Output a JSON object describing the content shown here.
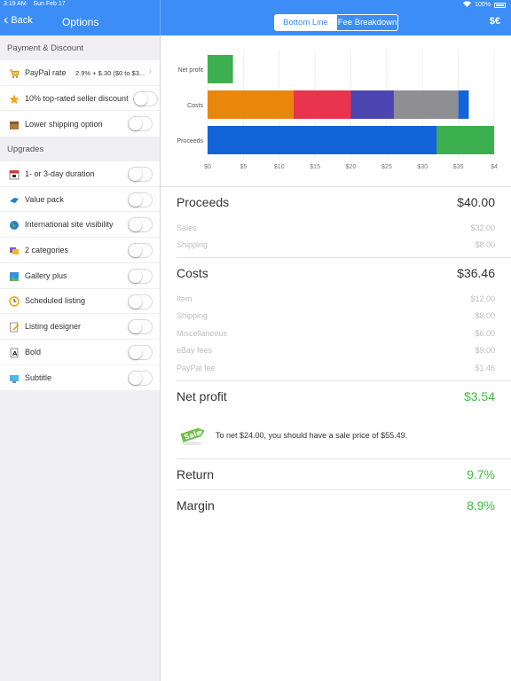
{
  "status": {
    "time": "3:19 AM",
    "date": "Sun Feb 17",
    "battery": "100%"
  },
  "nav": {
    "back_label": "Back",
    "title": "Options",
    "segments": [
      "Bottom Line",
      "Fee Breakdown"
    ],
    "selected_segment": "Bottom Line",
    "right_icon": "$€"
  },
  "sidebar": {
    "sections": [
      {
        "header": "Payment & Discount",
        "items": [
          {
            "label": "PayPal rate",
            "detail": "2.9% + $.30 ($0 to $3...",
            "icon": "cart-icon",
            "control": "disclosure"
          },
          {
            "label": "10% top-rated seller discount",
            "icon": "star-icon",
            "control": "toggle",
            "on": false
          },
          {
            "label": "Lower shipping option",
            "icon": "box-icon",
            "control": "toggle",
            "on": false
          }
        ]
      },
      {
        "header": "Upgrades",
        "items": [
          {
            "label": "1- or 3-day duration",
            "icon": "calendar-icon",
            "control": "toggle",
            "on": false
          },
          {
            "label": "Value pack",
            "icon": "tag-icon",
            "control": "toggle",
            "on": false
          },
          {
            "label": "International site visibility",
            "icon": "globe-icon",
            "control": "toggle",
            "on": false
          },
          {
            "label": "2 categories",
            "icon": "folders-icon",
            "control": "toggle",
            "on": false
          },
          {
            "label": "Gallery plus",
            "icon": "gallery-icon",
            "control": "toggle",
            "on": false
          },
          {
            "label": "Scheduled listing",
            "icon": "clock-icon",
            "control": "toggle",
            "on": false
          },
          {
            "label": "Listing designer",
            "icon": "designer-icon",
            "control": "toggle",
            "on": false
          },
          {
            "label": "Bold",
            "icon": "bold-icon",
            "control": "toggle",
            "on": false
          },
          {
            "label": "Subtitle",
            "icon": "subtitle-icon",
            "control": "toggle",
            "on": false
          }
        ]
      }
    ]
  },
  "chart_data": {
    "type": "bar",
    "orientation": "horizontal",
    "stacked": true,
    "categories": [
      "Net profit",
      "Costs",
      "Proceeds"
    ],
    "xlim": [
      0,
      40
    ],
    "xticks": [
      "$0",
      "$5",
      "$10",
      "$15",
      "$20",
      "$25",
      "$30",
      "$35",
      "$4"
    ],
    "grid": true,
    "bars": [
      {
        "category": "Net profit",
        "segments": [
          {
            "value": 3.54,
            "color": "#3cb04e"
          }
        ]
      },
      {
        "category": "Costs",
        "segments": [
          {
            "value": 12.0,
            "color": "#e8870c"
          },
          {
            "value": 8.0,
            "color": "#e8344e"
          },
          {
            "value": 6.0,
            "color": "#4a45b0"
          },
          {
            "value": 9.0,
            "color": "#8e8e93"
          },
          {
            "value": 1.46,
            "color": "#1264d8"
          }
        ]
      },
      {
        "category": "Proceeds",
        "segments": [
          {
            "value": 32.0,
            "color": "#1264d8"
          },
          {
            "value": 8.0,
            "color": "#3cb04e"
          }
        ]
      }
    ]
  },
  "summary": {
    "proceeds": {
      "label": "Proceeds",
      "value": "$40.00",
      "items": [
        {
          "label": "Sales",
          "value": "$32.00"
        },
        {
          "label": "Shipping",
          "value": "$8.00"
        }
      ]
    },
    "costs": {
      "label": "Costs",
      "value": "$36.46",
      "items": [
        {
          "label": "Item",
          "value": "$12.00"
        },
        {
          "label": "Shipping",
          "value": "$8.00"
        },
        {
          "label": "Miscellaneous",
          "value": "$6.00"
        },
        {
          "label": "eBay fees",
          "value": "$9.00"
        },
        {
          "label": "PayPal fee",
          "value": "$1.46"
        }
      ]
    },
    "net_profit": {
      "label": "Net profit",
      "value": "$3.54"
    },
    "tip": {
      "tag_text": "Sale",
      "text": "To net $24.00, you should have a sale price of $55.49."
    },
    "return": {
      "label": "Return",
      "value": "9.7%"
    },
    "margin": {
      "label": "Margin",
      "value": "8.9%"
    }
  },
  "colors": {
    "accent": "#3c8ef6",
    "positive": "#3bbf3b",
    "sidebar_bg": "#efeff4"
  }
}
